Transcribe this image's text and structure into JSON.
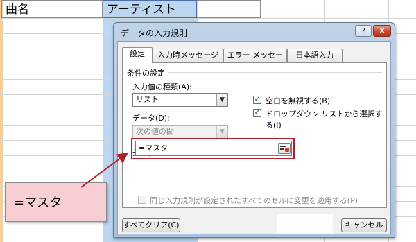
{
  "sheet": {
    "header_left": "曲名",
    "header_right": "アーティスト"
  },
  "dialog": {
    "title": "データの入力規則",
    "help_label": "?",
    "close_label": "X",
    "tabs": [
      {
        "label": "設定"
      },
      {
        "label": "入力時メッセージ"
      },
      {
        "label": "エラー メッセージ"
      },
      {
        "label": "日本語入力"
      }
    ],
    "group_title": "条件の設定",
    "allow_label": "入力値の種類(A):",
    "allow_value": "リスト",
    "data_label": "データ(D):",
    "data_value": "次の値の間",
    "ignore_blank_label": "空白を無視する(B)",
    "ignore_blank_checked": true,
    "dropdown_label": "ドロップダウン リストから選択する(I)",
    "dropdown_checked": true,
    "source_label": "元の値(S):",
    "source_value": "=マスタ",
    "apply_all_label": "同じ入力規則が設定されたすべてのセルに変更を適用する(P)",
    "apply_all_checked": false,
    "clear_all_label": "すべてクリア(C)",
    "cancel_label": "キャンセル"
  },
  "callout": {
    "text": "=マスタ",
    "color": "#f7cfd2"
  },
  "colors": {
    "highlight_border": "#b0202a",
    "arrow": "#b0202a",
    "selected_column": "#bcd6f0"
  }
}
